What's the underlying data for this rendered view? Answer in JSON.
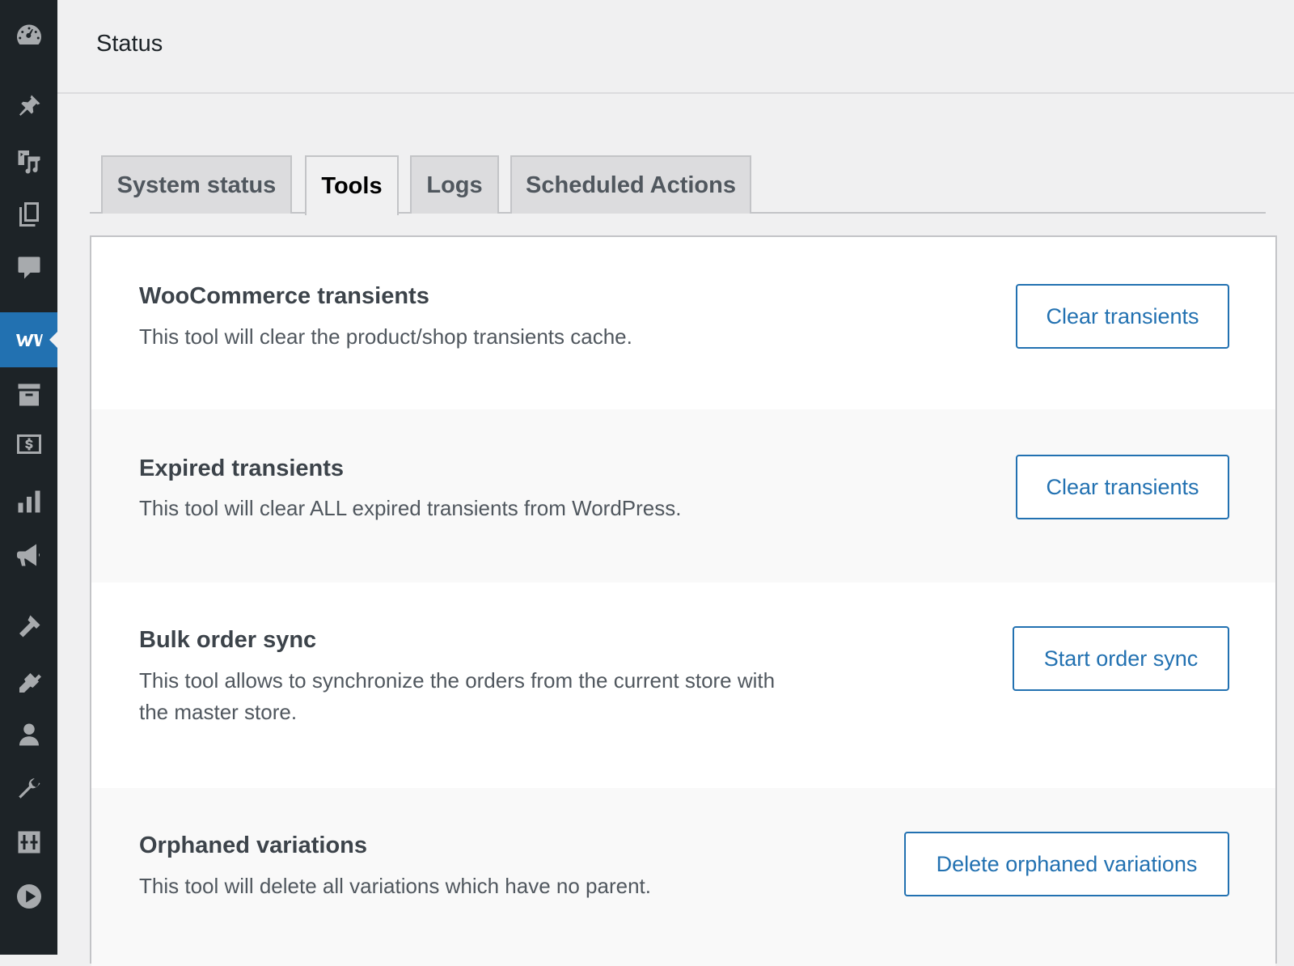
{
  "header": {
    "title": "Status"
  },
  "sidebar": {
    "items": [
      {
        "icon": "dashboard-icon"
      },
      {
        "icon": "pin-icon"
      },
      {
        "icon": "media-icon"
      },
      {
        "icon": "pages-icon"
      },
      {
        "icon": "comments-icon"
      },
      {
        "icon": "woocommerce-icon",
        "active": true
      },
      {
        "icon": "archive-icon"
      },
      {
        "icon": "payments-icon"
      },
      {
        "icon": "analytics-icon"
      },
      {
        "icon": "marketing-icon"
      },
      {
        "icon": "appearance-icon"
      },
      {
        "icon": "plugins-icon"
      },
      {
        "icon": "users-icon"
      },
      {
        "icon": "tools-icon"
      },
      {
        "icon": "settings-icon"
      },
      {
        "icon": "play-icon"
      }
    ],
    "accent_color": "#2271b1"
  },
  "tabs": [
    {
      "label": "System status",
      "active": false
    },
    {
      "label": "Tools",
      "active": true
    },
    {
      "label": "Logs",
      "active": false
    },
    {
      "label": "Scheduled Actions",
      "active": false
    }
  ],
  "tools": [
    {
      "title": "WooCommerce transients",
      "description": "This tool will clear the product/shop transients cache.",
      "button": "Clear transients"
    },
    {
      "title": "Expired transients",
      "description": "This tool will clear ALL expired transients from WordPress.",
      "button": "Clear transients"
    },
    {
      "title": "Bulk order sync",
      "description": "This tool allows to synchronize the orders from the current store with the master store.",
      "button": "Start order sync"
    },
    {
      "title": "Orphaned variations",
      "description": "This tool will delete all variations which have no parent.",
      "button": "Delete orphaned variations"
    }
  ]
}
